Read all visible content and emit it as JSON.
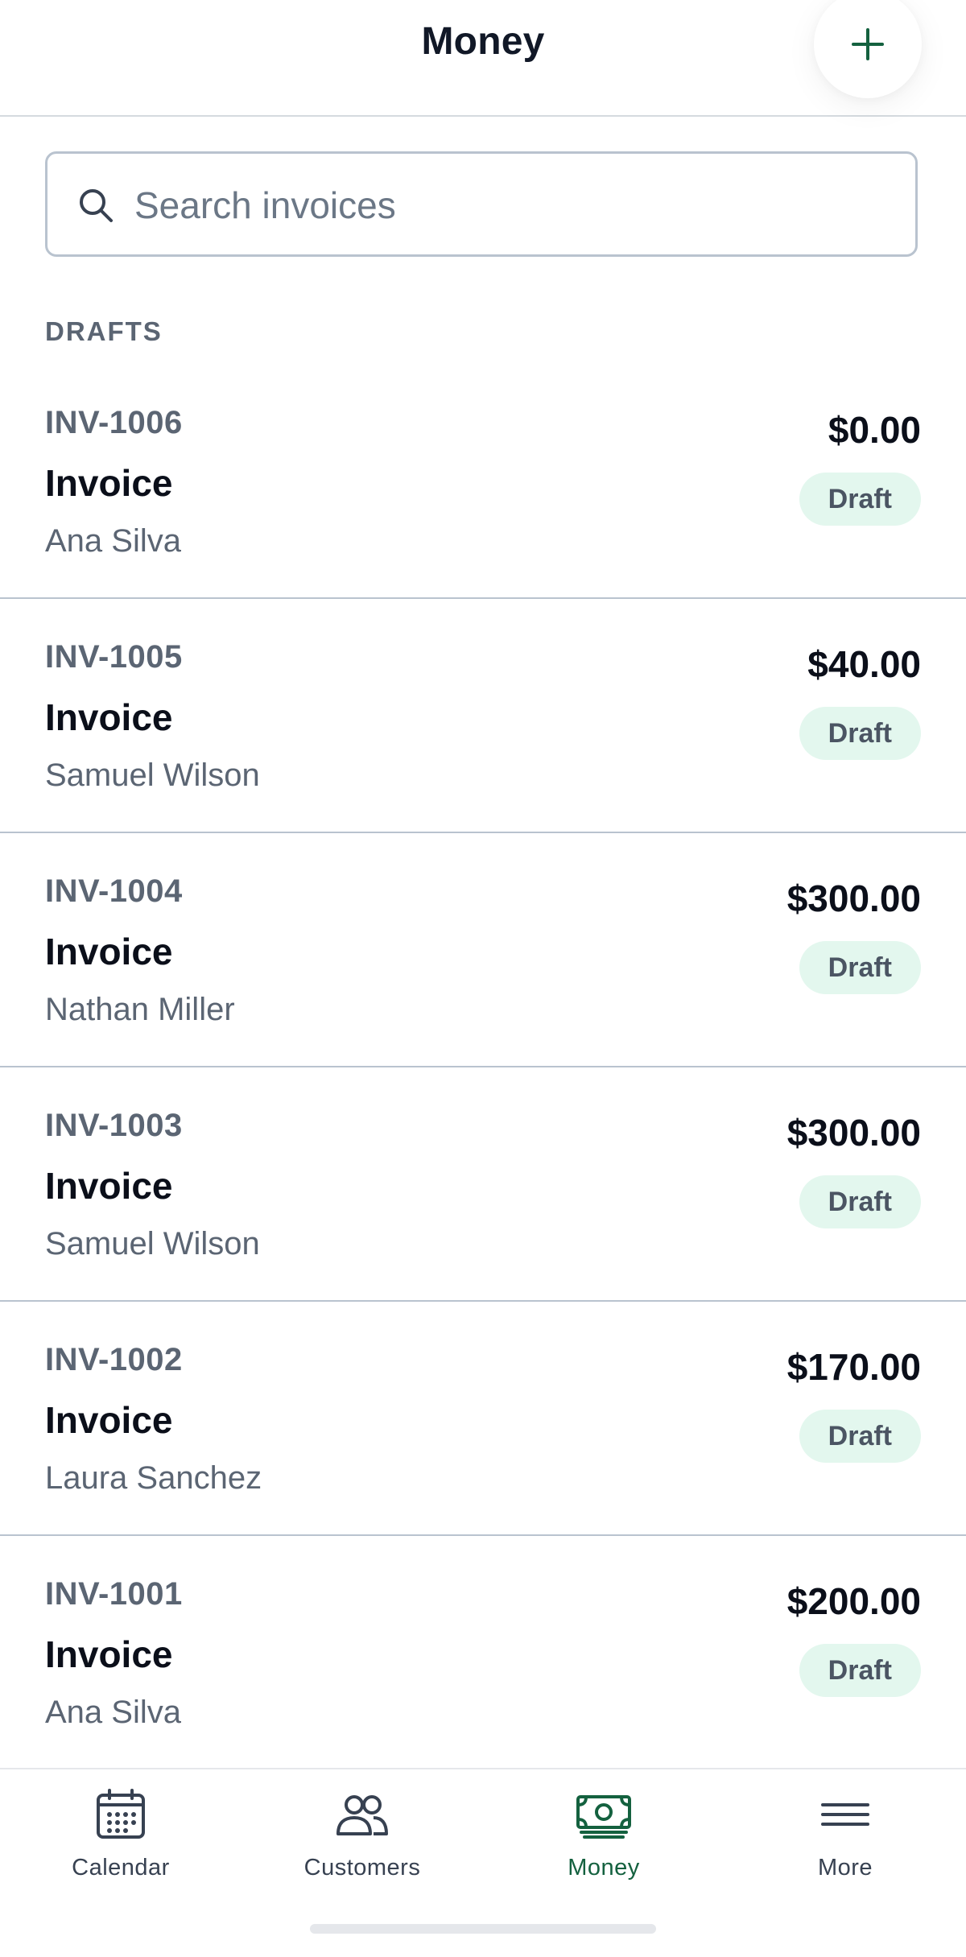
{
  "header": {
    "title": "Money",
    "add_icon": "plus-icon"
  },
  "search": {
    "placeholder": "Search invoices",
    "value": ""
  },
  "section": {
    "label": "DRAFTS"
  },
  "invoices": [
    {
      "number": "INV-1006",
      "title": "Invoice",
      "customer": "Ana Silva",
      "amount": "$0.00",
      "status": "Draft"
    },
    {
      "number": "INV-1005",
      "title": "Invoice",
      "customer": "Samuel Wilson",
      "amount": "$40.00",
      "status": "Draft"
    },
    {
      "number": "INV-1004",
      "title": "Invoice",
      "customer": "Nathan Miller",
      "amount": "$300.00",
      "status": "Draft"
    },
    {
      "number": "INV-1003",
      "title": "Invoice",
      "customer": "Samuel Wilson",
      "amount": "$300.00",
      "status": "Draft"
    },
    {
      "number": "INV-1002",
      "title": "Invoice",
      "customer": "Laura Sanchez",
      "amount": "$170.00",
      "status": "Draft"
    },
    {
      "number": "INV-1001",
      "title": "Invoice",
      "customer": "Ana Silva",
      "amount": "$200.00",
      "status": "Draft"
    }
  ],
  "tabs": [
    {
      "label": "Calendar",
      "icon": "calendar-icon",
      "active": false
    },
    {
      "label": "Customers",
      "icon": "customers-icon",
      "active": false
    },
    {
      "label": "Money",
      "icon": "money-icon",
      "active": true
    },
    {
      "label": "More",
      "icon": "menu-icon",
      "active": false
    }
  ],
  "colors": {
    "accent": "#14613f",
    "badge_bg": "#e3f7ee",
    "divider": "#b9c3cf",
    "muted_text": "#5b6573"
  }
}
